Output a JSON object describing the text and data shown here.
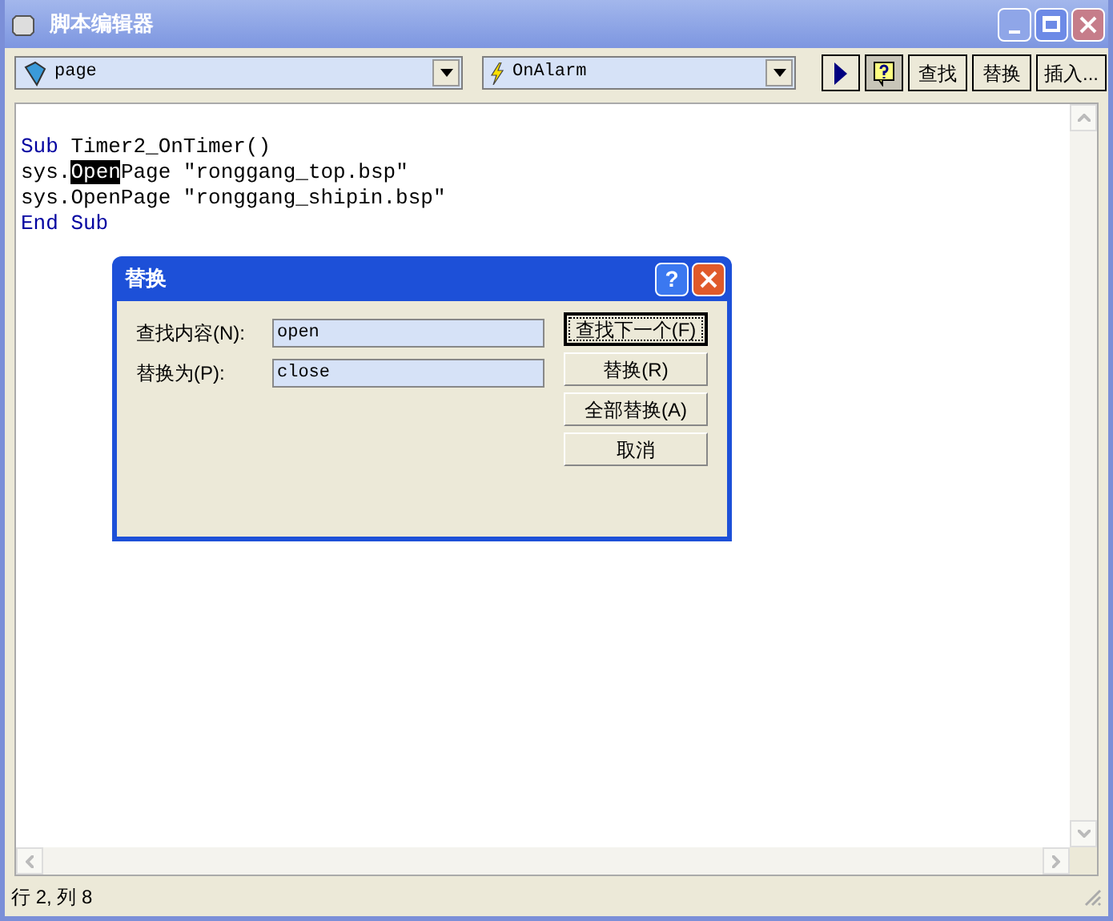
{
  "window": {
    "title": "脚本编辑器"
  },
  "toolbar": {
    "object_combo": {
      "value": "page"
    },
    "event_combo": {
      "value": "OnAlarm"
    },
    "buttons": [
      {
        "kind": "run",
        "pressed": false
      },
      {
        "kind": "help",
        "pressed": true
      },
      {
        "kind": "text",
        "label": "查找",
        "pressed": false
      },
      {
        "kind": "text",
        "label": "替换",
        "pressed": false
      },
      {
        "kind": "text",
        "label": "插入...",
        "pressed": false
      }
    ]
  },
  "code_lines": [
    [
      {
        "text": "Sub",
        "kind": "keyword"
      },
      {
        "text": " Timer2_OnTimer()",
        "kind": "plain"
      }
    ],
    [
      {
        "text": "sys.",
        "kind": "plain"
      },
      {
        "text": "Open",
        "kind": "selection"
      },
      {
        "text": "Page \"ronggang_top.bsp\"",
        "kind": "plain"
      }
    ],
    [
      {
        "text": "sys.OpenPage \"ronggang_shipin.bsp\"",
        "kind": "plain"
      }
    ],
    [
      {
        "text": "End",
        "kind": "keyword"
      },
      {
        "text": " Sub",
        "kind": "keyword"
      }
    ]
  ],
  "dialog": {
    "title": "替换",
    "help_label": "?",
    "fields": [
      {
        "label": "查找内容(N):",
        "value": "open"
      },
      {
        "label": "替换为(P):",
        "value": "close"
      }
    ],
    "buttons": [
      {
        "label": "查找下一个(F)",
        "default": true
      },
      {
        "label": "替换(R)",
        "default": false
      },
      {
        "label": "全部替换(A)",
        "default": false
      },
      {
        "label": "取消",
        "default": false
      }
    ]
  },
  "status_bar": {
    "position": "行 2, 列 8"
  }
}
